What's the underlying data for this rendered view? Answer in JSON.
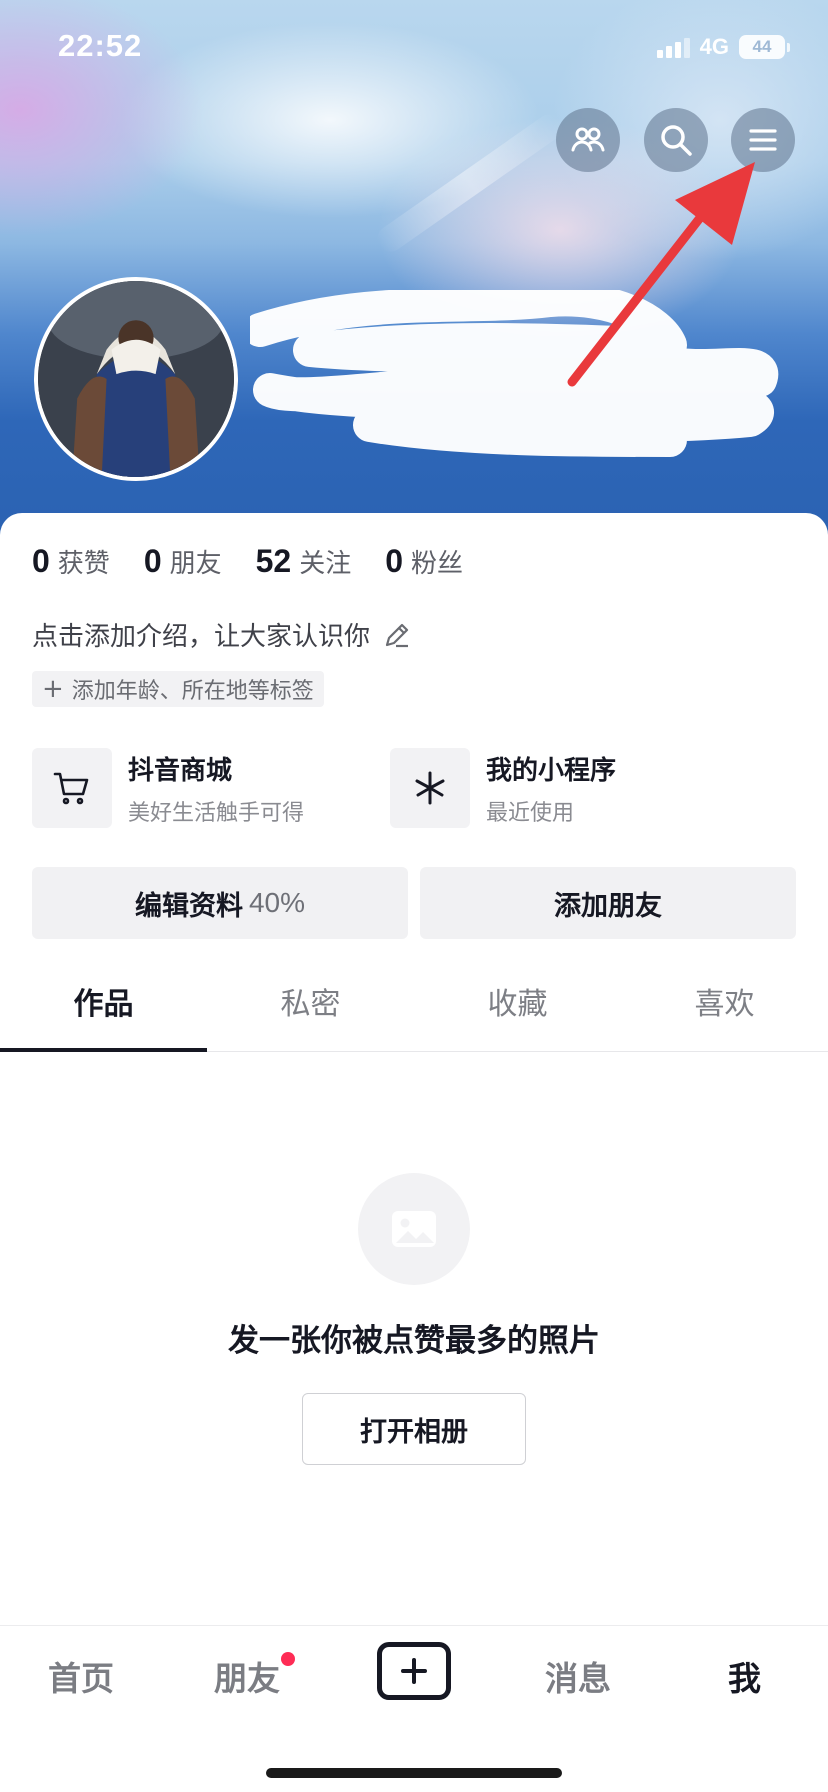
{
  "status_bar": {
    "time": "22:52",
    "network": "4G",
    "battery": "44"
  },
  "header": {
    "icons": [
      "friends-icon",
      "search-icon",
      "menu-icon"
    ],
    "annotation_arrow_color": "#e9393c"
  },
  "stats": [
    {
      "value": "0",
      "label": "获赞"
    },
    {
      "value": "0",
      "label": "朋友"
    },
    {
      "value": "52",
      "label": "关注"
    },
    {
      "value": "0",
      "label": "粉丝"
    }
  ],
  "bio": {
    "placeholder": "点击添加介绍，让大家认识你",
    "tag_chip": "添加年龄、所在地等标签"
  },
  "features": [
    {
      "title": "抖音商城",
      "subtitle": "美好生活触手可得",
      "icon": "cart-icon"
    },
    {
      "title": "我的小程序",
      "subtitle": "最近使用",
      "icon": "mini-program-icon"
    }
  ],
  "actions": {
    "edit_profile": "编辑资料",
    "edit_progress": "40%",
    "add_friends": "添加朋友"
  },
  "tabs": [
    {
      "label": "作品",
      "active": true
    },
    {
      "label": "私密",
      "active": false
    },
    {
      "label": "收藏",
      "active": false
    },
    {
      "label": "喜欢",
      "active": false
    }
  ],
  "empty_state": {
    "title": "发一张你被点赞最多的照片",
    "button": "打开相册",
    "icon": "image-icon"
  },
  "bottom_nav": {
    "items": [
      "首页",
      "朋友",
      "消息",
      "我"
    ],
    "active": "我",
    "badge_on": "朋友",
    "badge_color": "#fe2c55"
  }
}
